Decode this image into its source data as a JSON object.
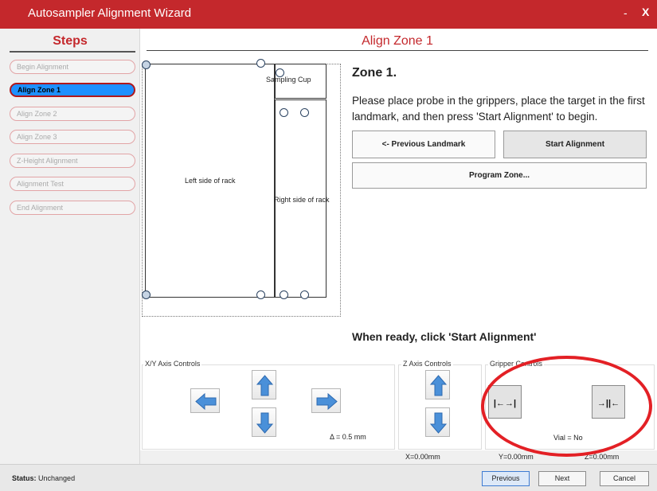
{
  "window": {
    "title": "Autosampler Alignment Wizard",
    "minimize": "-",
    "close": "X"
  },
  "sidebar": {
    "heading": "Steps",
    "items": [
      {
        "label": "Begin Alignment"
      },
      {
        "label": "Align Zone 1",
        "active": true
      },
      {
        "label": "Align Zone 2"
      },
      {
        "label": "Align Zone 3"
      },
      {
        "label": "Z-Height Alignment"
      },
      {
        "label": "Alignment Test"
      },
      {
        "label": "End Alignment"
      }
    ]
  },
  "main": {
    "heading": "Align Zone 1",
    "rack": {
      "left_label": "Left side of rack",
      "right_label": "Right side of rack",
      "cup_label": "Sampling Cup"
    },
    "zone_title": "Zone 1.",
    "instructions": "Please place probe in the grippers, place the target in the first landmark, and then press 'Start Alignment' to begin.",
    "prev_landmark_label": "<- Previous Landmark",
    "start_alignment_label": "Start Alignment",
    "program_zone_label": "Program Zone...",
    "ready_text": "When ready, click 'Start Alignment'"
  },
  "controls": {
    "xy_label": "X/Y Axis Controls",
    "delta": "Δ = 0.5 mm",
    "z_label": "Z Axis Controls",
    "gripper_label": "Gripper Controls",
    "gripper_open_glyph": "|←→|",
    "gripper_close_glyph": "→||←",
    "vial_status": "Vial = No"
  },
  "coordinates": {
    "x": "X=0.00mm",
    "y": "Y=0.00mm",
    "z": "Z=0.00mm"
  },
  "status": {
    "label": "Status:",
    "value": "Unchanged"
  },
  "footer": {
    "previous": "Previous",
    "next": "Next",
    "cancel": "Cancel"
  },
  "colors": {
    "accent": "#c4282c",
    "active_step": "#1e90ff",
    "arrow": "#4a90d9",
    "highlight": "#e32025"
  }
}
